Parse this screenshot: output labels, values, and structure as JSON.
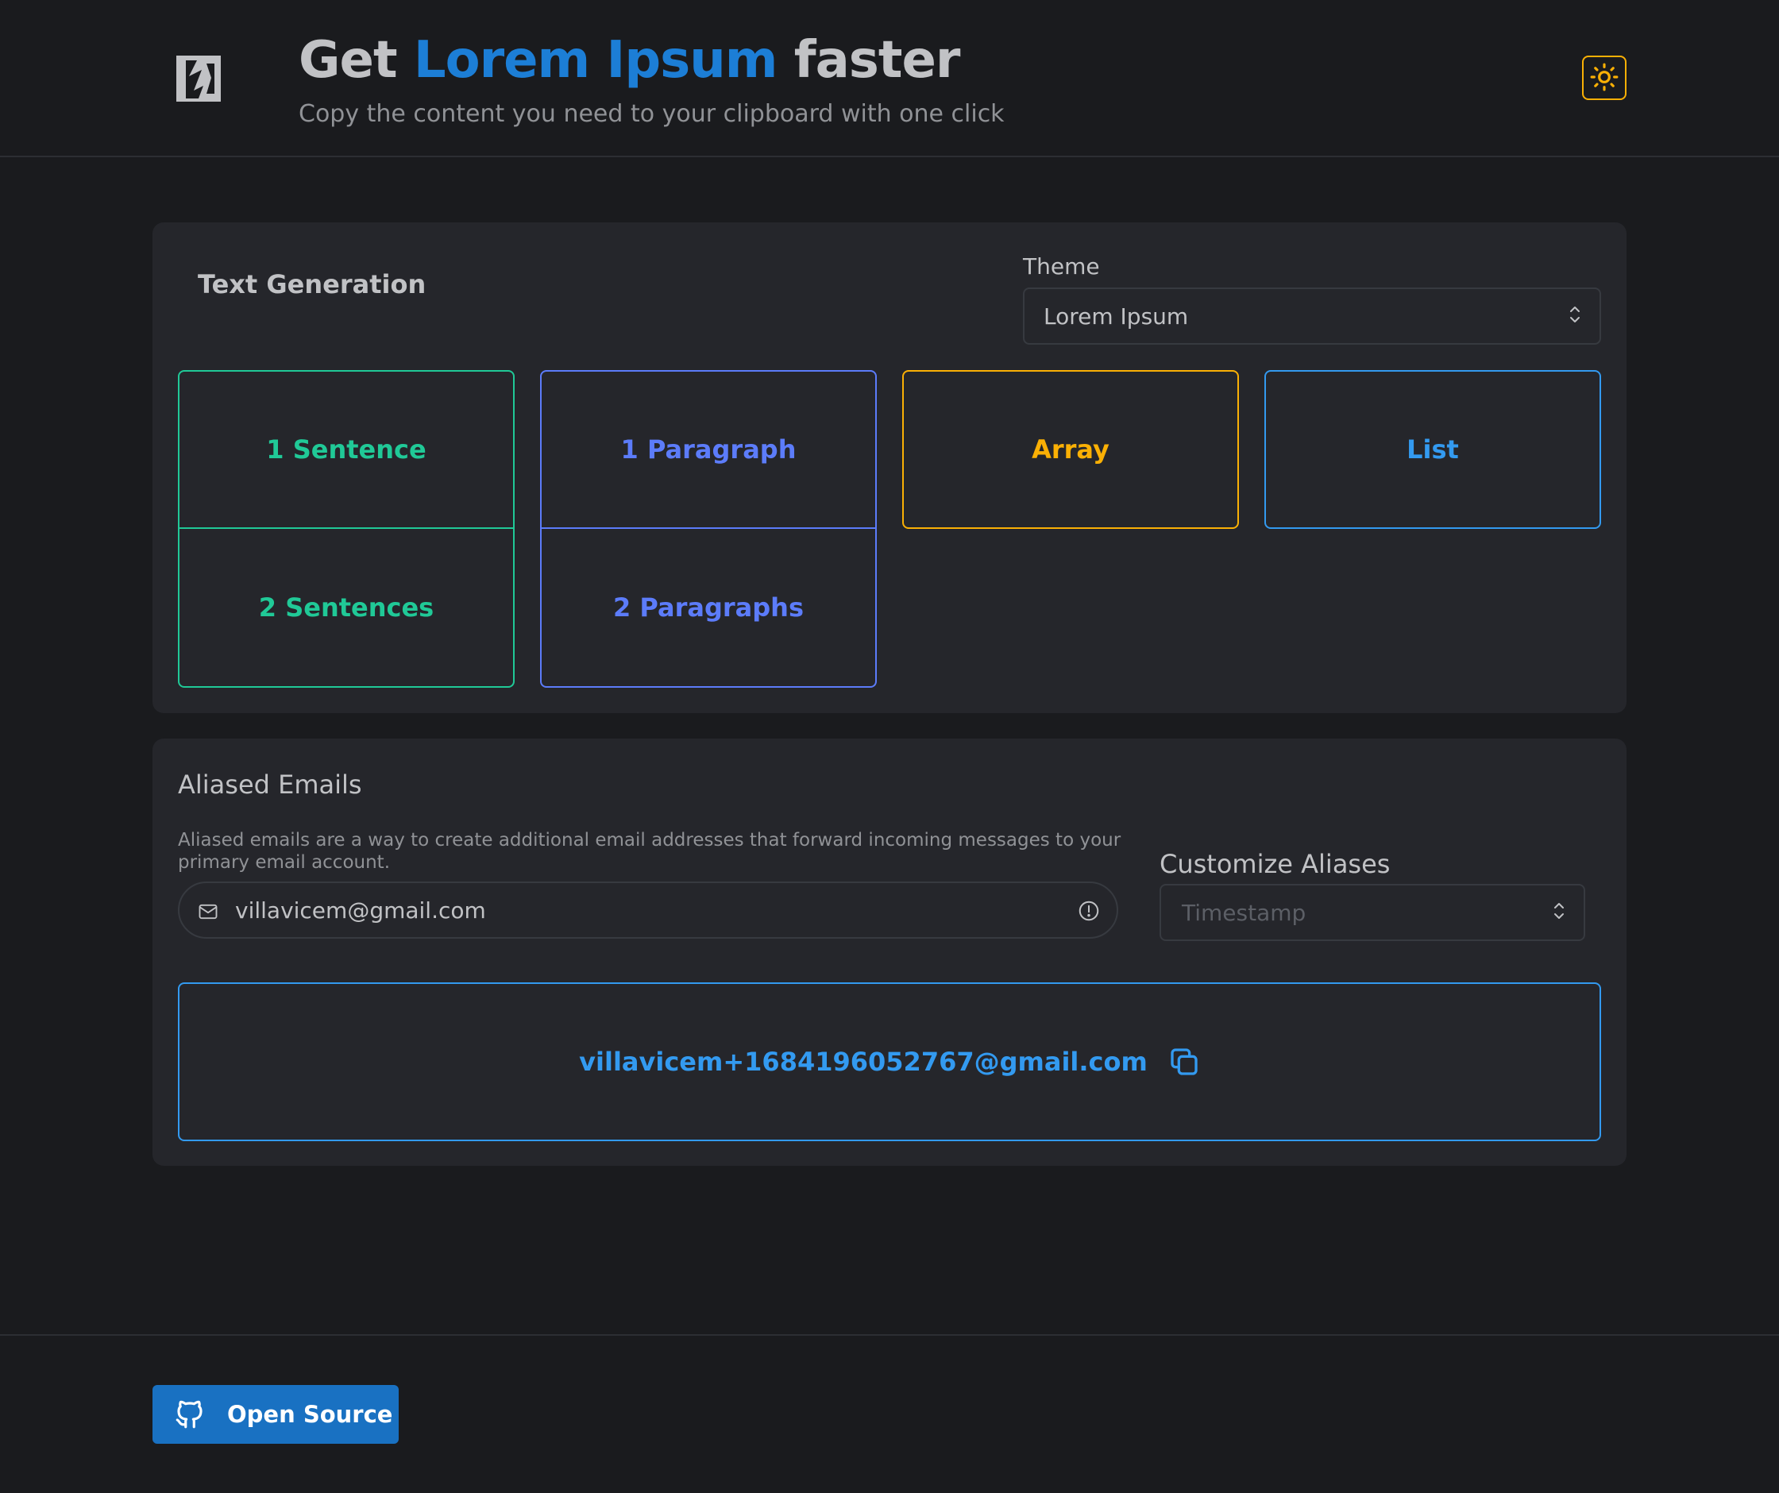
{
  "header": {
    "title_prefix": "Get ",
    "title_accent": "Lorem Ipsum",
    "title_suffix": " faster",
    "subtitle": "Copy the content you need to your clipboard with one click",
    "theme_toggle_icon": "sun-icon"
  },
  "text_generation": {
    "title": "Text Generation",
    "theme_label": "Theme",
    "theme_value": "Lorem Ipsum",
    "buttons": {
      "sentence_1": "1 Sentence",
      "sentence_2": "2 Sentences",
      "paragraph_1": "1 Paragraph",
      "paragraph_2": "2 Paragraphs",
      "array": "Array",
      "list": "List"
    }
  },
  "aliased_emails": {
    "title": "Aliased Emails",
    "description": "Aliased emails are a way to create additional email addresses that forward incoming messages to your primary email account.",
    "email_value": "villavicem@gmail.com",
    "customize_label": "Customize Aliases",
    "customize_placeholder": "Timestamp",
    "result": "villavicem+1684196052767@gmail.com"
  },
  "footer": {
    "open_source_label": "Open Source"
  },
  "colors": {
    "background": "#1a1b1e",
    "card": "#25262b",
    "accent_blue": "#1c7ed6",
    "green": "#20c997",
    "indigo": "#5c7cfa",
    "yellow": "#fab005",
    "blue": "#339af0"
  }
}
